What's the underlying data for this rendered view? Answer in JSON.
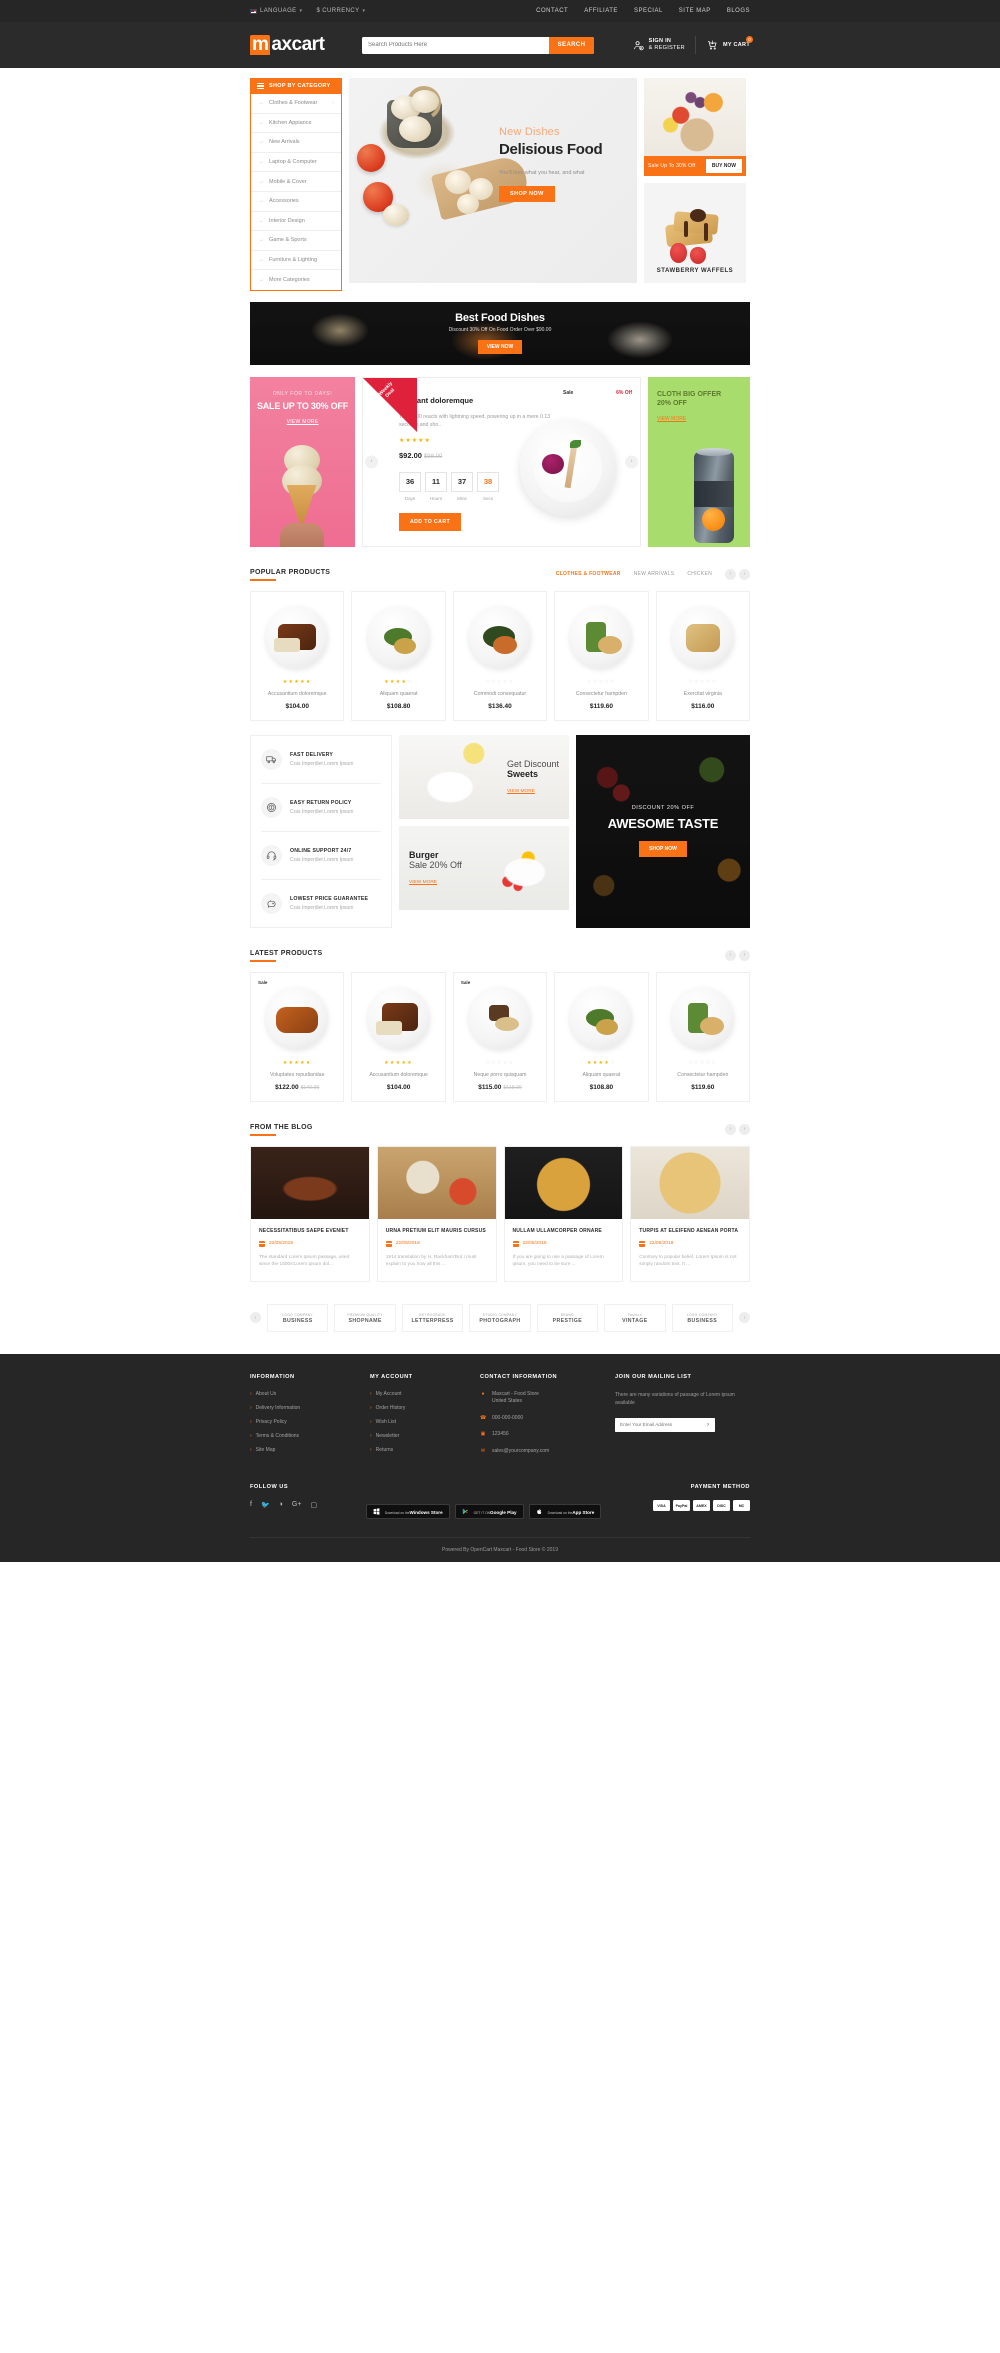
{
  "topbar": {
    "language": "LANGUAGE",
    "currency": "$ CURRENCY",
    "links": [
      "CONTACT",
      "AFFILIATE",
      "SPECIAL",
      "SITE MAP",
      "BLOGS"
    ]
  },
  "header": {
    "logo_m": "m",
    "logo_rest": "axcart",
    "search_placeholder": "Search Products Here",
    "search_button": "SEARCH",
    "signin_line1": "SIGN IN",
    "signin_line2": "& REGISTER",
    "cart_label": "MY CART",
    "cart_count": "0"
  },
  "category": {
    "heading": "SHOP BY CATEGORY",
    "items": [
      "Clothes & Footwear",
      "Kitchen Appiance",
      "New Arrivals",
      "Laptop & Computer",
      "Mobile & Cover",
      "Accessories",
      "Interior Design",
      "Game & Sports",
      "Furniture & Lighting",
      "More Categories"
    ]
  },
  "hero": {
    "subtitle": "New Dishes",
    "title": "Delisious Food",
    "desc": "You'll love what you hear, and what",
    "button": "SHOP NOW"
  },
  "side_banners": {
    "offer_label": "Sale Up To 30% Off",
    "offer_button": "BUY NOW",
    "waffle_label": "STAWBERRY WAFFELS"
  },
  "wide_banner": {
    "title": "Best Food Dishes",
    "sub": "Discount 30% Off On Food Order Over $90.00",
    "button": "VIEW NOW"
  },
  "deal": {
    "left": {
      "eyebrow": "ONLY FOR TO DAYS!",
      "title": "SALE UP TO 30% OFF",
      "link": "VIEW MORE"
    },
    "ribbon_line1": "Weekly",
    "ribbon_line2": "Deal",
    "title": "Laudant doloremque",
    "desc": "The D300 reacts with lightning speed, powering up in a mere 0.13 seconds and sho..",
    "stars": 5,
    "price": "$92.00",
    "old_price": "$98.00",
    "sale_label": "Sale",
    "off_label": "6% Off",
    "countdown": [
      {
        "value": "36",
        "label": "Days"
      },
      {
        "value": "11",
        "label": "Hours"
      },
      {
        "value": "37",
        "label": "Mins"
      },
      {
        "value": "38",
        "label": "Secs"
      }
    ],
    "add_to_cart": "ADD TO CART",
    "right": {
      "line1": "CLOTH BIG OFFER",
      "line2": "20% OFF",
      "link": "VIEW MORE"
    }
  },
  "popular": {
    "title": "POPULAR PRODUCTS",
    "tabs": [
      "CLOTHES & FOOTWEAR",
      "NEW ARRIVALS",
      "CHICKEN"
    ],
    "active_tab": 0,
    "products": [
      {
        "name": "Accusantium doloremque",
        "price": "$104.00",
        "old_price": "",
        "stars": 5,
        "sale": ""
      },
      {
        "name": "Aliquam quaerat",
        "price": "$108.80",
        "old_price": "",
        "stars": 4,
        "sale": ""
      },
      {
        "name": "Commodi consequatur",
        "price": "$136.40",
        "old_price": "",
        "stars": 0,
        "sale": ""
      },
      {
        "name": "Consectetur hampden",
        "price": "$119.60",
        "old_price": "",
        "stars": 0,
        "sale": ""
      },
      {
        "name": "Exercitat virginia",
        "price": "$116.00",
        "old_price": "",
        "stars": 0,
        "sale": ""
      }
    ]
  },
  "services": [
    {
      "title": "FAST DELIVERY",
      "desc": "Cras Imperdiet Lorem Ipsum",
      "icon": "truck-icon"
    },
    {
      "title": "EASY RETURN POLICY",
      "desc": "Cras Imperdiet Lorem Ipsum",
      "icon": "coin-icon"
    },
    {
      "title": "ONLINE SUPPORT 24/7",
      "desc": "Cras Imperdiet Lorem Ipsum",
      "icon": "headset-icon"
    },
    {
      "title": "LOWEST PRICE GUARANTEE",
      "desc": "Cras Imperdiet Lorem Ipsum",
      "icon": "piggy-bank-icon"
    }
  ],
  "promos": {
    "sweets": {
      "line1": "Get Discount",
      "line2": "Sweets",
      "link": "VIEW MORE"
    },
    "burger": {
      "line1": "Burger",
      "line2": "Sale 20% Off",
      "link": "VIEW MORE"
    },
    "dark": {
      "eyebrow": "DISCOUNT 20% OFF",
      "title": "AWESOME TASTE",
      "button": "SHOP NOW"
    }
  },
  "latest": {
    "title": "LATEST PRODUCTS",
    "products": [
      {
        "name": "Voluptates repudiandae",
        "price": "$122.00",
        "old_price": "$140.00",
        "stars": 5,
        "sale": "Sale"
      },
      {
        "name": "Accusantium doloremque",
        "price": "$104.00",
        "old_price": "",
        "stars": 5,
        "sale": ""
      },
      {
        "name": "Neque porro quisquam",
        "price": "$115.00",
        "old_price": "$118.00",
        "stars": 0,
        "sale": "Sale"
      },
      {
        "name": "Aliquam quaerat",
        "price": "$108.80",
        "old_price": "",
        "stars": 4,
        "sale": ""
      },
      {
        "name": "Consectetur hampden",
        "price": "$119.60",
        "old_price": "",
        "stars": 0,
        "sale": ""
      }
    ]
  },
  "blog": {
    "title": "FROM THE BLOG",
    "posts": [
      {
        "title": "NECESSITATIBUS SAEPE EVENIET",
        "date": "22/05/2018",
        "excerpt": "The standard Lorem Ipsum passage, used since the 1500s'Lorem ipsum dol..."
      },
      {
        "title": "URNA PRETIUM ELIT MAURIS CURSUS",
        "date": "22/05/2018",
        "excerpt": "1914 translation by H. Rackham'But I must explain to you how all this ..."
      },
      {
        "title": "NULLAM ULLAMCORPER ORNARE",
        "date": "22/05/2018",
        "excerpt": "If you are going to use a passage of Lorem ipsum, you need to be sure ..."
      },
      {
        "title": "TURPIS AT ELEIFEND AENEAN PORTA",
        "date": "22/05/2018",
        "excerpt": "Contrary to popular belief, Lorem Ipsum is not simply random text. It ..."
      }
    ]
  },
  "brands": [
    {
      "name": "BUSINESS",
      "sub": "LOGO COMPANY"
    },
    {
      "name": "SHOPNAME",
      "sub": "PREMIUM QUALITY"
    },
    {
      "name": "LETTERPRESS",
      "sub": "RETROGRADE"
    },
    {
      "name": "PHOTOGRAPH",
      "sub": "STUDIO COMPANY"
    },
    {
      "name": "PRESTIGE",
      "sub": "BRAND"
    },
    {
      "name": "VINTAGE",
      "sub": "Fashion"
    },
    {
      "name": "BUSINESS",
      "sub": "LOGO COMPANY"
    }
  ],
  "footer": {
    "information": {
      "heading": "INFORMATION",
      "links": [
        "About Us",
        "Delivery Information",
        "Privacy Policy",
        "Terms & Conditions",
        "Site Map"
      ]
    },
    "account": {
      "heading": "MY ACCOUNT",
      "links": [
        "My Account",
        "Order History",
        "Wish List",
        "Newsletter",
        "Returns"
      ]
    },
    "contact": {
      "heading": "CONTACT INFORMATION",
      "items": [
        {
          "icon": "location-icon",
          "text": "Maxcart - Food Store\nUnited States"
        },
        {
          "icon": "phone-icon",
          "text": "000-000-0000"
        },
        {
          "icon": "fax-icon",
          "text": "123456"
        },
        {
          "icon": "mail-icon",
          "text": "sales@yourcompany.com"
        }
      ]
    },
    "newsletter": {
      "heading": "JOIN OUR MAILING LIST",
      "note": "There are many variations of passage of Lorem ipsum available",
      "placeholder": "Enter Your Email Address",
      "button": "›"
    },
    "follow": {
      "heading": "FOLLOW US",
      "icons": [
        "facebook-icon",
        "twitter-icon",
        "rss-icon",
        "google-plus-icon",
        "instagram-icon"
      ]
    },
    "apps": [
      {
        "top": "Download on the",
        "bottom": "Windows Store",
        "icon": "windows-icon"
      },
      {
        "top": "GET IT ON",
        "bottom": "Google Play",
        "icon": "play-icon"
      },
      {
        "top": "Download on the",
        "bottom": "App Store",
        "icon": "apple-icon"
      }
    ],
    "payment": {
      "heading": "PAYMENT METHOD",
      "cards": [
        "VISA",
        "PayPal",
        "AMEX",
        "DISC",
        "MC"
      ]
    },
    "copyright": "Powered By OpenCart Maxcart - Food Store © 2019",
    "copyright_brand": "OpenCart"
  }
}
